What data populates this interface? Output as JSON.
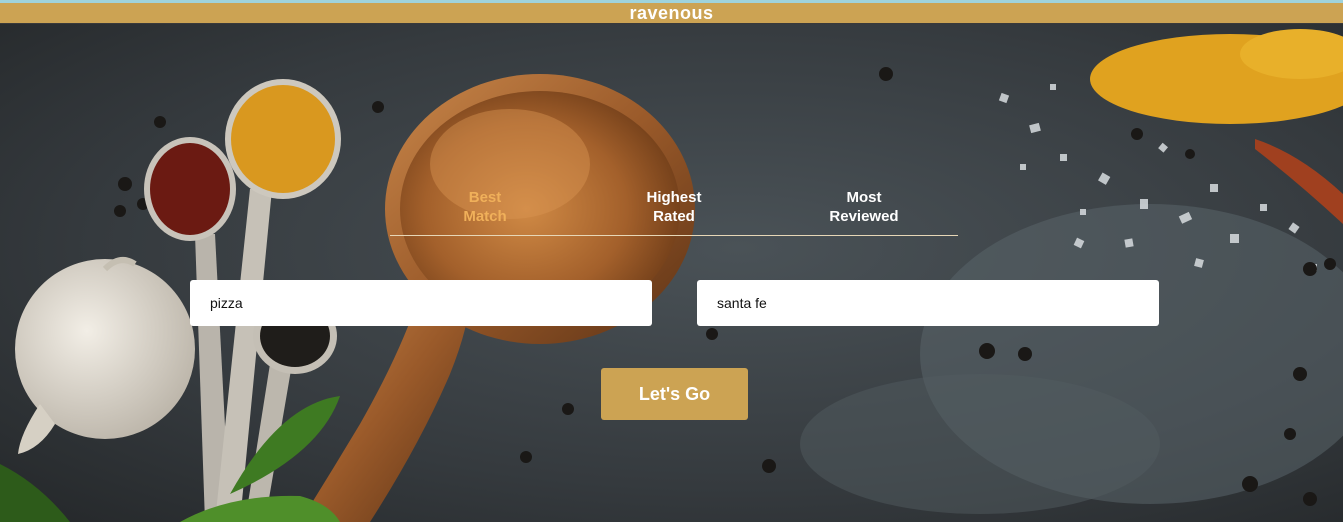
{
  "header": {
    "brand": "ravenous"
  },
  "sort_options": [
    {
      "line1": "Best",
      "line2": "Match",
      "active": true
    },
    {
      "line1": "Highest",
      "line2": "Rated",
      "active": false
    },
    {
      "line1": "Most",
      "line2": "Reviewed",
      "active": false
    }
  ],
  "search": {
    "term_value": "pizza",
    "location_value": "santa fe"
  },
  "actions": {
    "submit_label": "Let's Go"
  },
  "colors": {
    "brand_gold": "#cca353",
    "active_sort": "#f0b05a",
    "top_line": "#9fd3dc"
  }
}
